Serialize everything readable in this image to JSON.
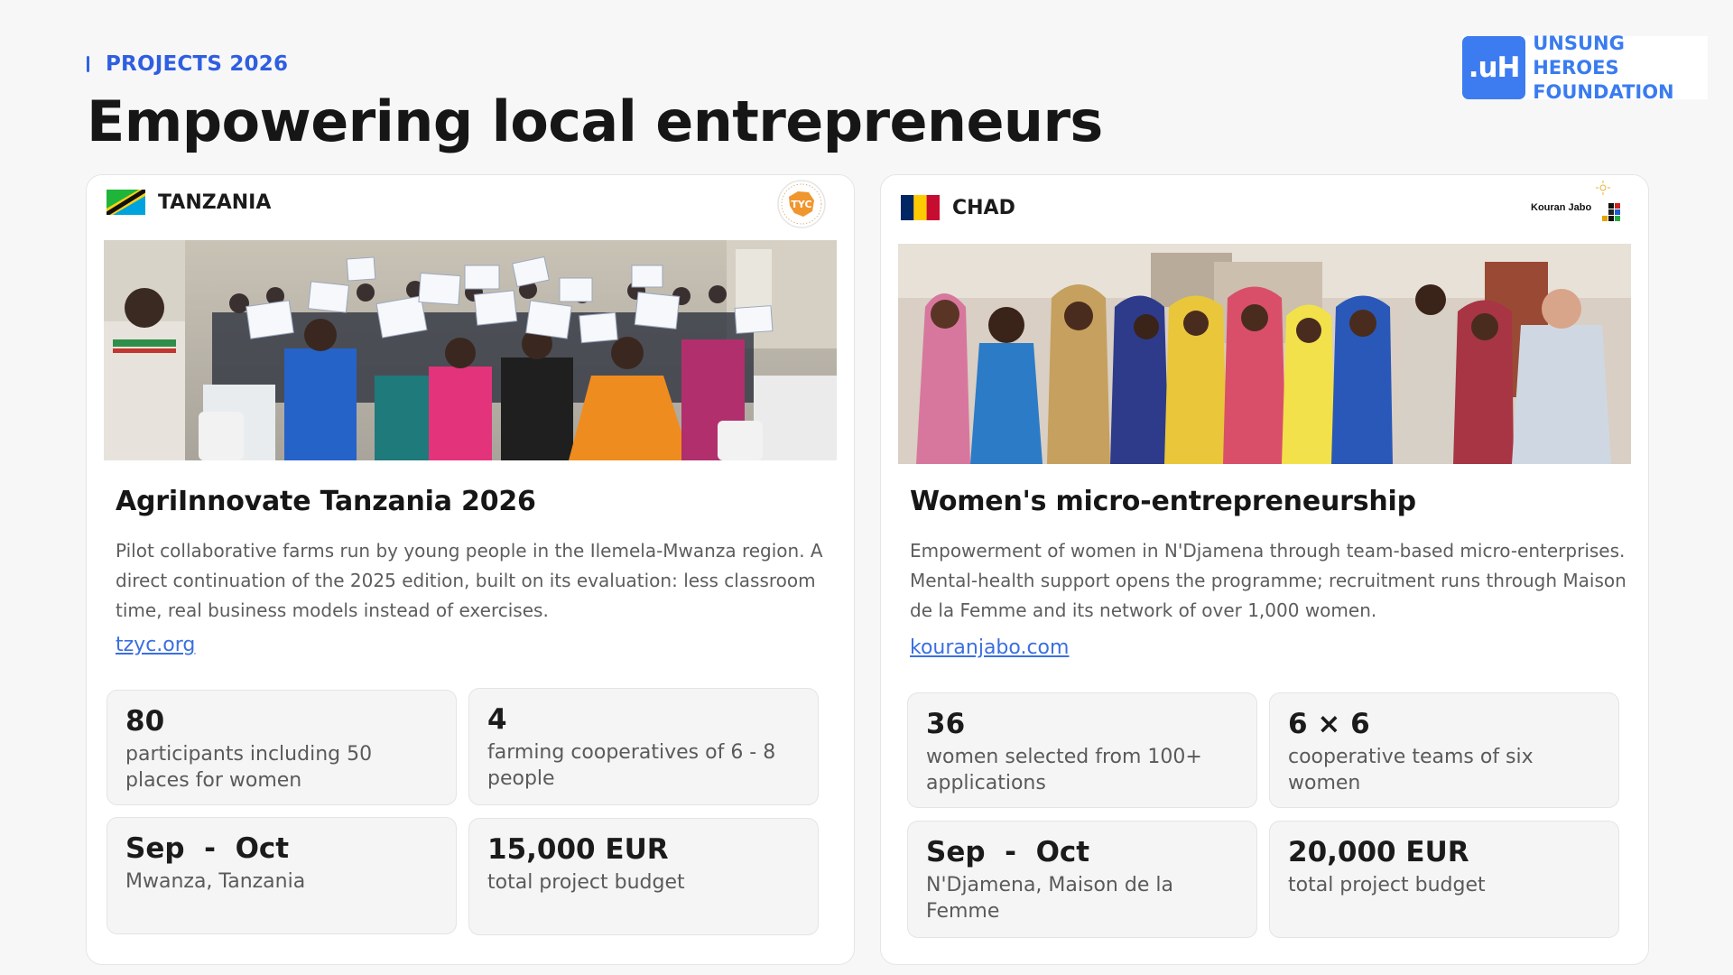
{
  "header": {
    "eyebrow": "PROJECTS 2026",
    "title": "Empowering local entrepreneurs"
  },
  "org": {
    "mark": ".uH",
    "name_line1": "UNSUNG HEROES",
    "name_line2": "FOUNDATION",
    "brand_color": "#3d7cf0"
  },
  "projects": [
    {
      "country": "TANZANIA",
      "flag_icon": "tanzania-flag-icon",
      "partner_logo": "TYC",
      "title": "AgriInnovate Tanzania 2026",
      "description": "Pilot collaborative farms run by young people in the Ilemela-Mwanza region. A direct continuation of the 2025 edition, built on its evaluation: less classroom time, real business models instead of exercises.",
      "link": "tzyc.org",
      "stats": [
        {
          "value": "80",
          "label": "participants including 50 places for women"
        },
        {
          "value": "4",
          "label": "farming cooperatives of 6 - 8 people"
        },
        {
          "value": "Sep  -  Oct",
          "label": "Mwanza, Tanzania"
        },
        {
          "value": "15,000 EUR",
          "label": "total project budget"
        }
      ]
    },
    {
      "country": "CHAD",
      "flag_icon": "chad-flag-icon",
      "partner_logo": "Kouran Jabo",
      "title": "Women's micro-entrepreneurship",
      "description": "Empowerment of women in N'Djamena through team-based micro-enterprises. Mental-health support opens the programme; recruitment runs through Maison de la Femme and its network of over 1,000 women.",
      "link": "kouranjabo.com",
      "stats": [
        {
          "value": "36",
          "label": "women selected from 100+ applications"
        },
        {
          "value": "6 × 6",
          "label": "cooperative teams of six women"
        },
        {
          "value": "Sep  -  Oct",
          "label": "N'Djamena, Maison de la Femme"
        },
        {
          "value": "20,000 EUR",
          "label": "total project budget"
        }
      ]
    }
  ]
}
